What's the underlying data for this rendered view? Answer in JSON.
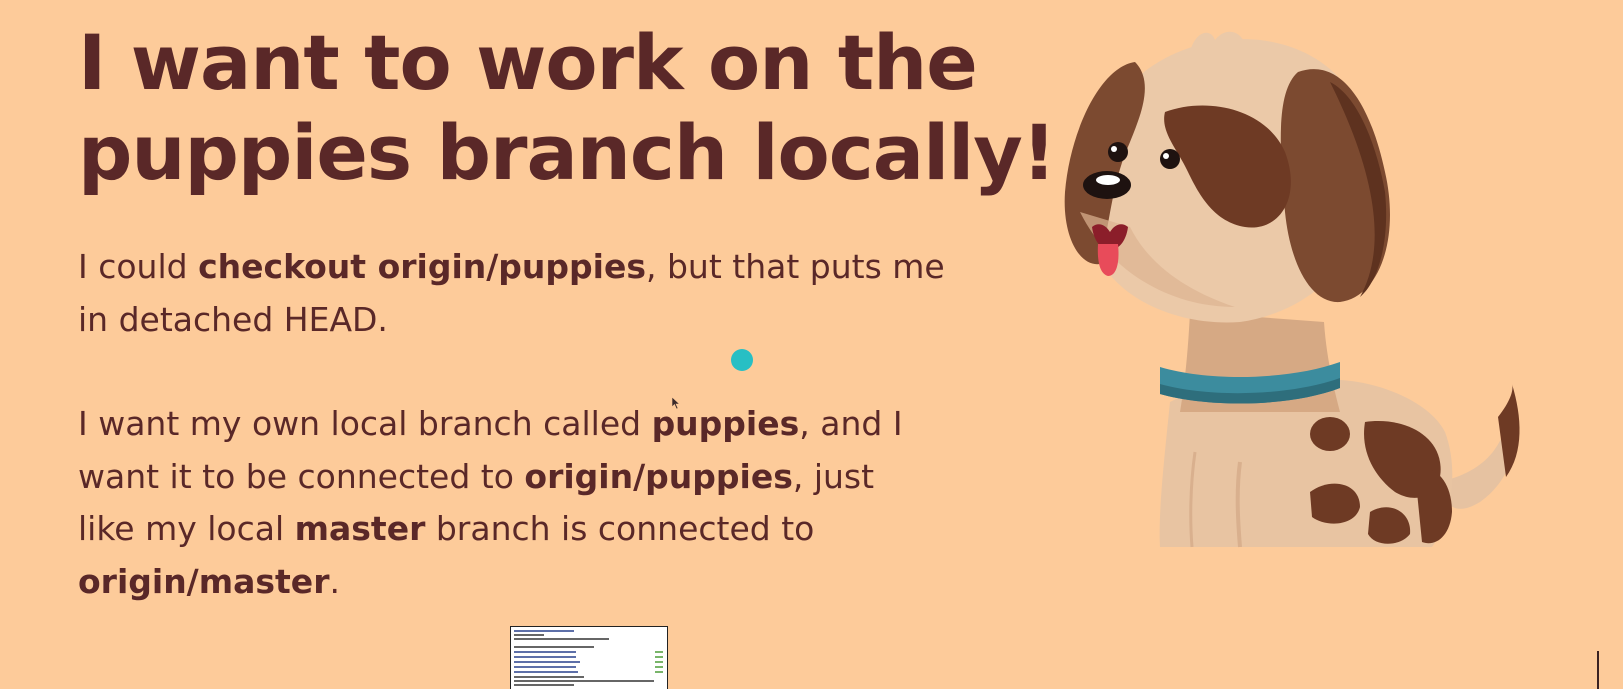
{
  "slide": {
    "title_lines": [
      "I want to work on the",
      "puppies branch locally!"
    ],
    "paragraph1": {
      "l1_a": "I could ",
      "l1_b": "checkout origin/puppies",
      "l1_c": ", but that puts me",
      "l2": "in detached HEAD."
    },
    "paragraph2": {
      "l1_a": "I want my own local branch called ",
      "l1_b": "puppies",
      "l1_c": ", and I",
      "l2_a": "want it to be connected to ",
      "l2_b": "origin/puppies",
      "l2_c": ", just",
      "l3_a": "like my local ",
      "l3_b": "master",
      "l3_c": " branch is connected to",
      "l4_a": "origin/master",
      "l4_b": "."
    }
  },
  "colors": {
    "background": "#FDCB9A",
    "text": "#5A2828",
    "pointer_dot": "#27BFC4",
    "puppy_collar": "#3C8C9E"
  },
  "icons": {
    "illustration": "puppy-illustration",
    "pointer": "laser-pointer-dot"
  }
}
